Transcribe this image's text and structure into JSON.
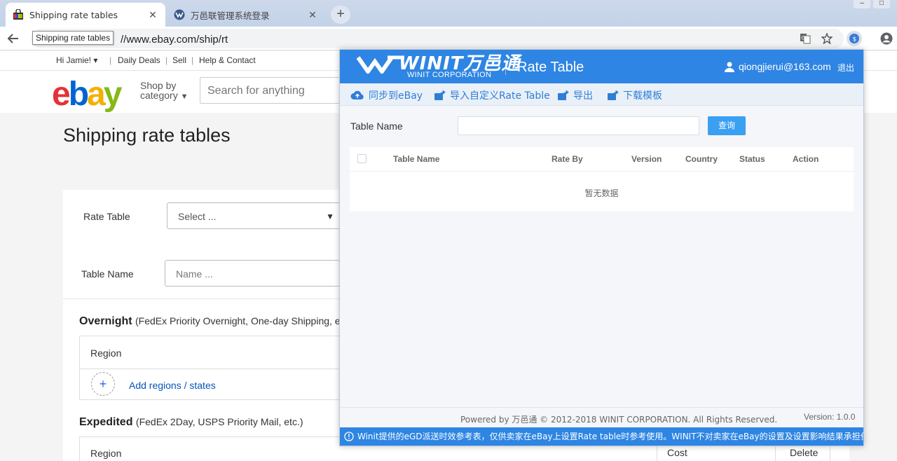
{
  "browser": {
    "tabs": [
      {
        "title": "Shipping rate tables",
        "active": true
      },
      {
        "title": "万邑联管理系统登录",
        "active": false
      }
    ],
    "new_tab": "+",
    "tab_close": "✕",
    "url": "//www.ebay.com/ship/rt",
    "tooltip": "Shipping rate tables",
    "icons": [
      "back-arrow-icon",
      "translate-icon",
      "star-icon",
      "extension-icon",
      "profile-icon",
      "menu-icon"
    ]
  },
  "ebay": {
    "greeting": "Hi Jamie!",
    "top_links": [
      "Daily Deals",
      "Sell",
      "Help & Contact"
    ],
    "shop_by": "Shop by",
    "category": "category",
    "search_placeholder": "Search for anything",
    "page_title": "Shipping rate tables",
    "rate_table_label": "Rate Table",
    "rate_table_select": "Select ...",
    "table_name_label": "Table Name",
    "table_name_placeholder": "Name ...",
    "overnight": {
      "title": "Overnight",
      "subtitle": "(FedEx Priority Overnight, One-day Shipping, etc."
    },
    "expedited": {
      "title": "Expedited",
      "subtitle": "(FedEx 2Day, USPS Priority Mail, etc.)"
    },
    "region_header": "Region",
    "add_regions": "Add regions / states",
    "cost_label": "Cost",
    "delete_label": "Delete"
  },
  "winit": {
    "logo_text": "WINIT万邑通",
    "logo_sub": "WINIT CORPORATION",
    "title": "Rate Table",
    "user": "qiongjierui@163.com",
    "logout": "退出",
    "actions": [
      "同步到eBay",
      "导入自定义Rate Table",
      "导出",
      "下载模板"
    ],
    "filter_label": "Table Name",
    "query_button": "查询",
    "columns": [
      "Table Name",
      "Rate By",
      "Version",
      "Country",
      "Status",
      "Action"
    ],
    "empty_text": "暂无数据",
    "powered": "Powered by 万邑通 © 2012-2018 WINIT CORPORATION. All Rights Reserved.",
    "version": "Version: 1.0.0",
    "notice": "Winit提供的eGD派送时效参考表，仅供卖家在eBay上设置Rate table时参考使用。WINIT不对卖家在eBay的设置及设置影响结果承担任何责任",
    "colors": {
      "header": "#2e85e3",
      "link": "#2e7ed8",
      "button": "#3aa0f2"
    }
  }
}
